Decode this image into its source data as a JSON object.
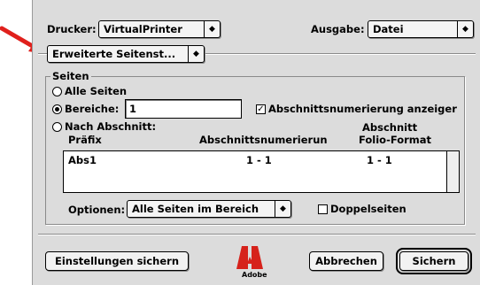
{
  "header": {
    "printer_label": "Drucker:",
    "printer_value": "VirtualPrinter",
    "output_label": "Ausgabe:",
    "output_value": "Datei"
  },
  "panel_menu": {
    "value": "Erweiterte Seitenst..."
  },
  "pages": {
    "group_label": "Seiten",
    "all_pages": "Alle Seiten",
    "ranges_label": "Bereiche:",
    "ranges_value": "1",
    "section_numbering_label": "Abschnittsnumerierung anzeiger",
    "section_numbering_checked": true,
    "by_section": "Nach Abschnitt:",
    "selected_option": "ranges",
    "table": {
      "col_prefix": "Präfix",
      "col_numbering": "Abschnittsnumerierun",
      "col_folio_line1": "Abschnitt",
      "col_folio_line2": "Folio-Format",
      "rows": [
        {
          "prefix": "Abs1",
          "numbering": "1 - 1",
          "folio": "1 - 1"
        }
      ]
    },
    "options_label": "Optionen:",
    "options_value": "Alle Seiten im Bereich",
    "double_pages_label": "Doppelseiten",
    "double_pages_checked": false
  },
  "footer": {
    "save_settings": "Einstellungen sichern",
    "logo_text": "Adobe",
    "cancel": "Abbrechen",
    "save": "Sichern"
  },
  "colors": {
    "arrow": "#e0201c",
    "logo": "#d6221b",
    "dialog_bg": "#dcdcdc"
  }
}
